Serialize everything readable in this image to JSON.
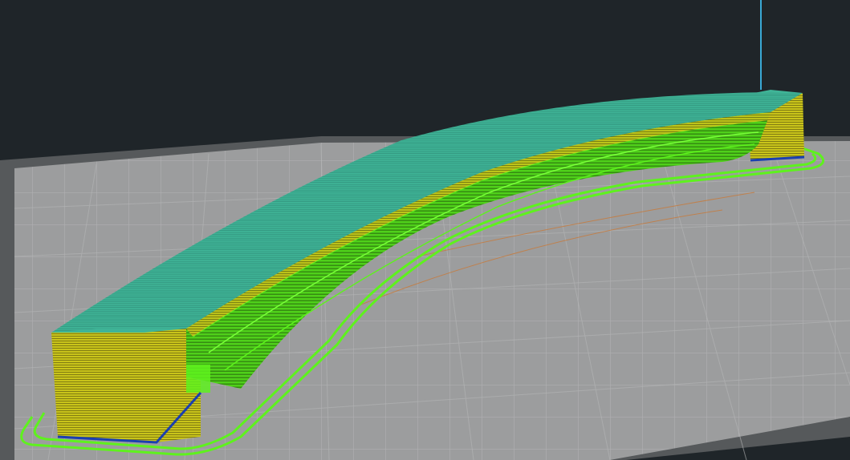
{
  "viewport": {
    "label": "",
    "colors": {
      "background": "#1f2529",
      "build_plate_top": "#9c9d9e",
      "build_plate_edge": "#56595b",
      "grid_line": "#b0b1b2",
      "outer_wall": "#c9c41a",
      "wall_shadow": "#6f6a10",
      "top_skin": "#3fb497",
      "infill": "#5ef21d",
      "skirt": "#5ef21d",
      "first_layer": "#1a3fb0",
      "axis_z": "#3aa9d6",
      "travel": "#c87a3a"
    }
  }
}
